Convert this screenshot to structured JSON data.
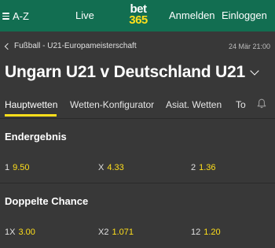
{
  "nav": {
    "menu_label": "A-Z",
    "live_label": "Live",
    "logo_line1": "bet",
    "logo_line2": "365",
    "login_label": "Anmelden",
    "signin_label": "Einloggen"
  },
  "header": {
    "breadcrumb": "Fußball - U21-Europameisterschaft",
    "datetime": "24 Mär 21:00",
    "title": "Ungarn U21 v Deutschland U21"
  },
  "tabs": [
    {
      "label": "Hauptwetten",
      "active": true
    },
    {
      "label": "Wetten-Konfigurator",
      "active": false
    },
    {
      "label": "Asiat. Wetten",
      "active": false
    },
    {
      "label": "To",
      "active": false
    }
  ],
  "markets": [
    {
      "title": "Endergebnis",
      "odds": [
        {
          "label": "1",
          "value": "9.50"
        },
        {
          "label": "X",
          "value": "4.33"
        },
        {
          "label": "2",
          "value": "1.36"
        }
      ]
    },
    {
      "title": "Doppelte Chance",
      "odds": [
        {
          "label": "1X",
          "value": "3.00"
        },
        {
          "label": "X2",
          "value": "1.071"
        },
        {
          "label": "12",
          "value": "1.20"
        }
      ]
    }
  ],
  "colors": {
    "nav_bg": "#126e51",
    "page_bg": "#383838",
    "accent": "#ffdf1b"
  },
  "icons": {
    "menu": "hamburger-icon",
    "back": "chevron-left-icon",
    "expand": "chevron-down-icon",
    "notifications": "bell-icon"
  }
}
